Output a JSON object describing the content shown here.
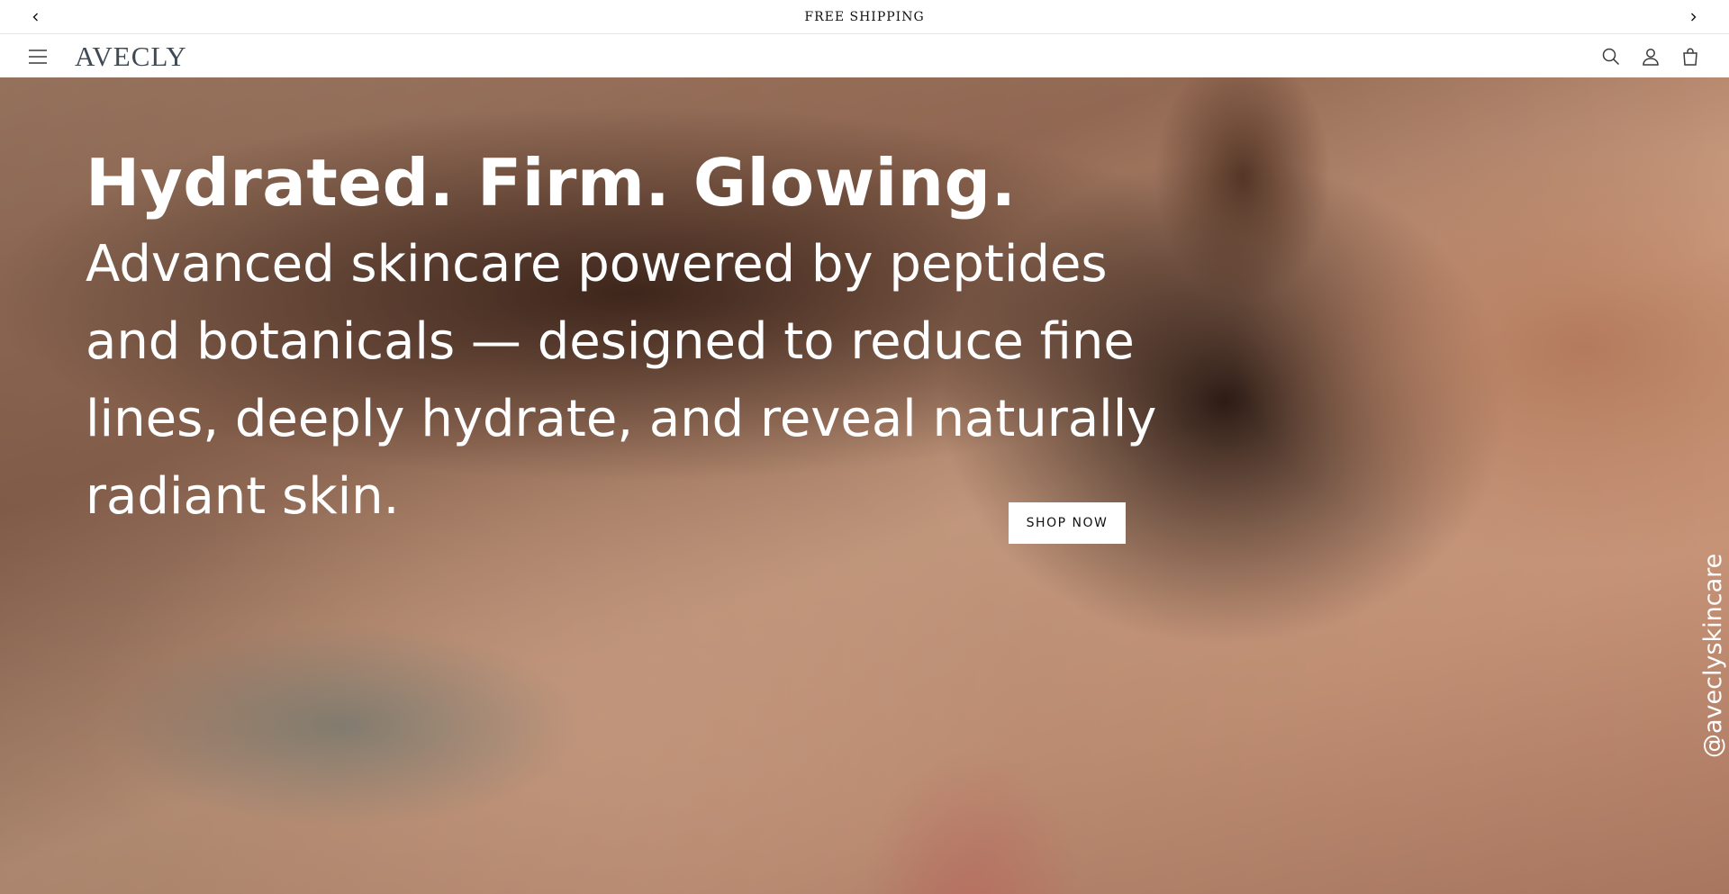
{
  "announcement": {
    "message": "FREE SHIPPING",
    "prev_icon": "chevron-left-icon",
    "next_icon": "chevron-right-icon"
  },
  "header": {
    "logo": "AVECLY",
    "menu_icon": "hamburger-menu-icon",
    "icons": [
      "search-icon",
      "account-icon",
      "cart-icon"
    ]
  },
  "hero": {
    "heading": "Hydrated. Firm. Glowing.",
    "subheading": "Advanced skincare powered by peptides and botanicals — designed to reduce fine lines, deeply hydrate, and reveal naturally radiant skin.",
    "cta_label": "SHOP NOW",
    "social_handle": "@aveclyskincare"
  },
  "colors": {
    "logo": "#3f4a54",
    "hero_text": "#ffffff",
    "button_bg": "#ffffff",
    "button_text": "#121212"
  }
}
